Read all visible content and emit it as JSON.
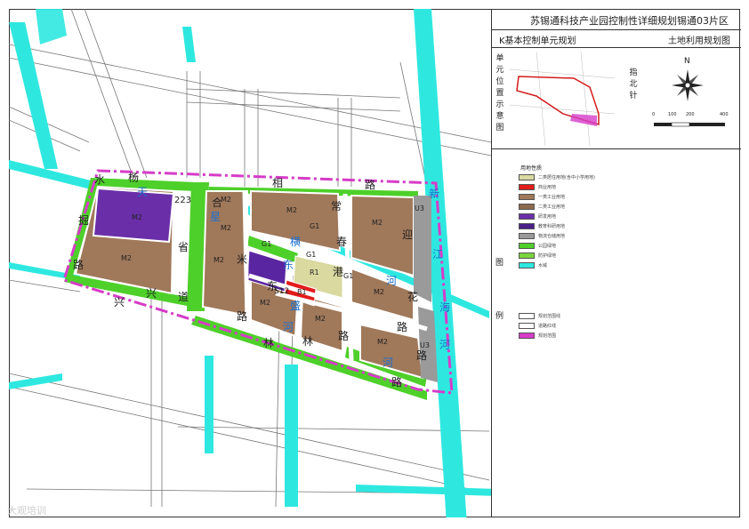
{
  "panel": {
    "title": "苏锡通科技产业园控制性详细规划锡通03片区",
    "subtitle_left": "K基本控制单元规划",
    "subtitle_right": "土地利用规划图",
    "location_label": "单元位置示意图",
    "north_label": "指北针",
    "north_letter": "N",
    "scale_ticks": [
      "0",
      "100",
      "200",
      "400"
    ],
    "legend_label": "图",
    "legend_label2": "例",
    "landuse_title": "用地性质",
    "landuse": [
      {
        "label": "二类居住用地(含中小学用地)",
        "color": "#d9d9a0"
      },
      {
        "label": "商业用地",
        "color": "#e31c1c"
      },
      {
        "label": "一类工业用地",
        "color": "#a0785a"
      },
      {
        "label": "二类工业用地",
        "color": "#8b6a4e"
      },
      {
        "label": "研发用地",
        "color": "#6a2fa8"
      },
      {
        "label": "教育科研用地",
        "color": "#4a1f8a"
      },
      {
        "label": "物流仓储用地",
        "color": "#9a9a9a"
      },
      {
        "label": "公园绿地",
        "color": "#4ed02a"
      },
      {
        "label": "防护绿地",
        "color": "#7ad43c"
      },
      {
        "label": "水域",
        "color": "#2ee8e0"
      }
    ],
    "boundary_items": [
      {
        "label": "规划范围线",
        "color": "#ffffff"
      },
      {
        "label": "道路红线",
        "color": "#ffffff"
      },
      {
        "label": "规划范围",
        "color": "#d63cc8"
      }
    ]
  },
  "map": {
    "road_labels": [
      {
        "text": "水",
        "kind": "road"
      },
      {
        "text": "杨",
        "kind": "road"
      },
      {
        "text": "天",
        "kind": "road"
      },
      {
        "text": "223",
        "kind": "road"
      },
      {
        "text": "合",
        "kind": "road"
      },
      {
        "text": "相",
        "kind": "road"
      },
      {
        "text": "路",
        "kind": "road"
      },
      {
        "text": "常",
        "kind": "road"
      },
      {
        "text": "新",
        "kind": "river"
      },
      {
        "text": "星",
        "kind": "river"
      },
      {
        "text": "横",
        "kind": "river"
      },
      {
        "text": "春",
        "kind": "road"
      },
      {
        "text": "迎",
        "kind": "road"
      },
      {
        "text": "掘",
        "kind": "road"
      },
      {
        "text": "省",
        "kind": "road"
      },
      {
        "text": "米",
        "kind": "road"
      },
      {
        "text": "东",
        "kind": "river"
      },
      {
        "text": "江",
        "kind": "river"
      },
      {
        "text": "路",
        "kind": "road"
      },
      {
        "text": "港",
        "kind": "road"
      },
      {
        "text": "河",
        "kind": "river"
      },
      {
        "text": "兴",
        "kind": "road"
      },
      {
        "text": "道",
        "kind": "road"
      },
      {
        "text": "东",
        "kind": "road"
      },
      {
        "text": "S12",
        "kind": "road"
      },
      {
        "text": "花",
        "kind": "road"
      },
      {
        "text": "兴",
        "kind": "road"
      },
      {
        "text": "路",
        "kind": "road"
      },
      {
        "text": "盛",
        "kind": "river"
      },
      {
        "text": "路",
        "kind": "road"
      },
      {
        "text": "海",
        "kind": "river"
      },
      {
        "text": "河",
        "kind": "river"
      },
      {
        "text": "路",
        "kind": "road"
      },
      {
        "text": "林",
        "kind": "road"
      },
      {
        "text": "林",
        "kind": "road"
      },
      {
        "text": "河",
        "kind": "river"
      },
      {
        "text": "河",
        "kind": "river"
      },
      {
        "text": "路",
        "kind": "road"
      },
      {
        "text": "路",
        "kind": "road"
      }
    ],
    "plot_labels": [
      "M2",
      "M2",
      "M2",
      "M2",
      "M2",
      "M2",
      "M2",
      "M2",
      "M2",
      "M2",
      "M2",
      "G1",
      "G1",
      "G1",
      "G1",
      "R1",
      "B1",
      "U3",
      "U3"
    ],
    "watermark": "大观培训"
  }
}
